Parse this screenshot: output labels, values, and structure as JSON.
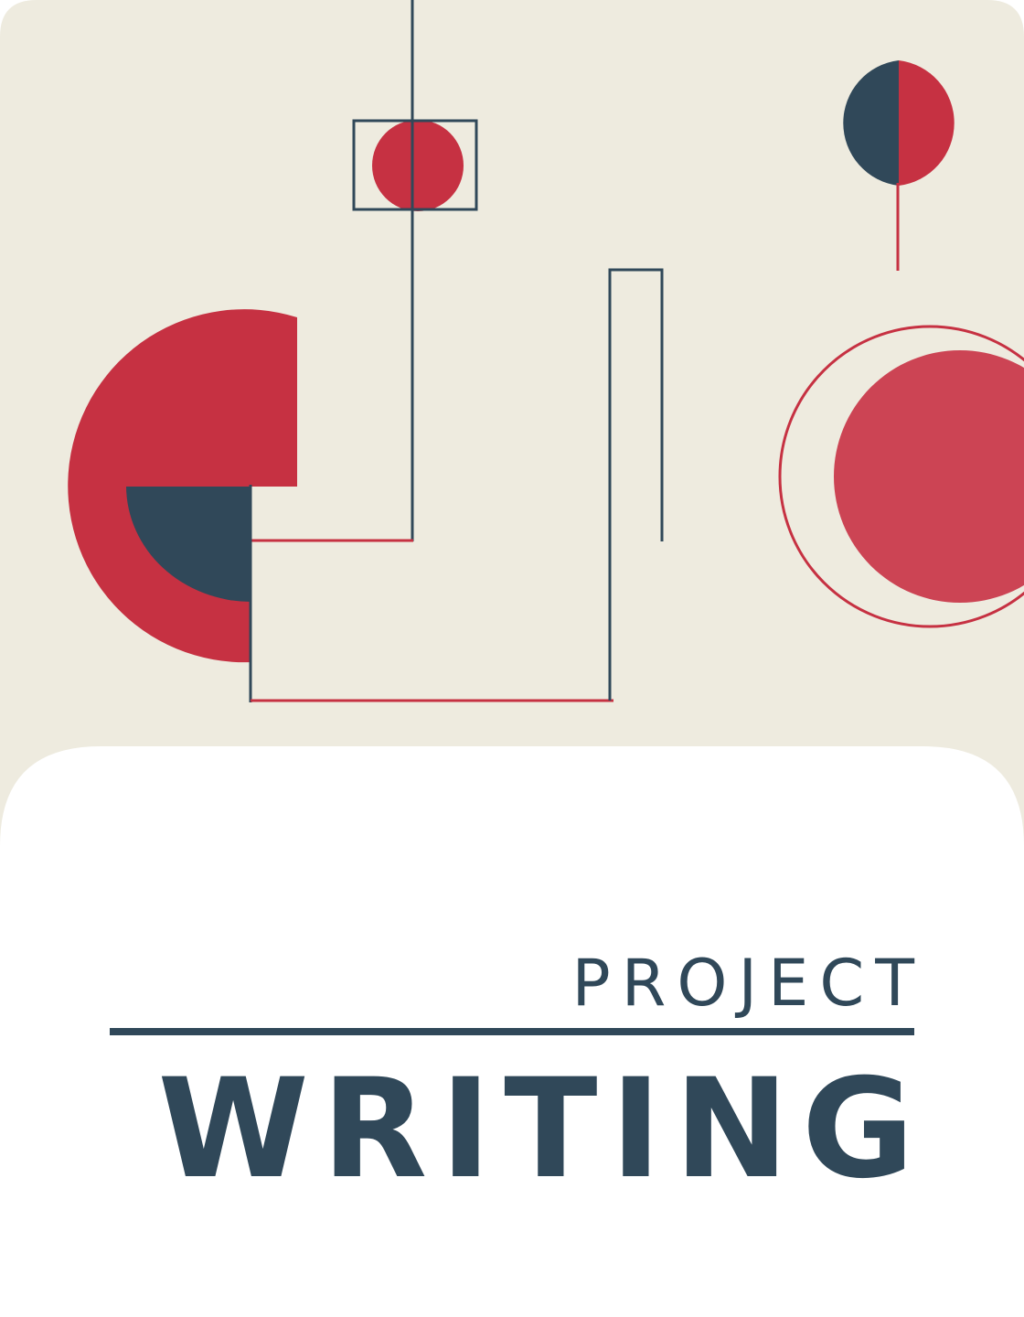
{
  "cover": {
    "kicker": "PROJECT",
    "title": "WRITING"
  },
  "colors": {
    "background_panel": "#EEEBDF",
    "red": "#C63142",
    "light_red": "#CC4454",
    "navy": "#304859",
    "white": "#FFFFFF"
  },
  "artwork": {
    "style": "geometric abstract illustration",
    "shapes": [
      "half-circle-navy-red",
      "red-circle-in-square",
      "large-red-segment",
      "navy-quarter-circle",
      "light-red-circle",
      "outline-circle"
    ]
  }
}
